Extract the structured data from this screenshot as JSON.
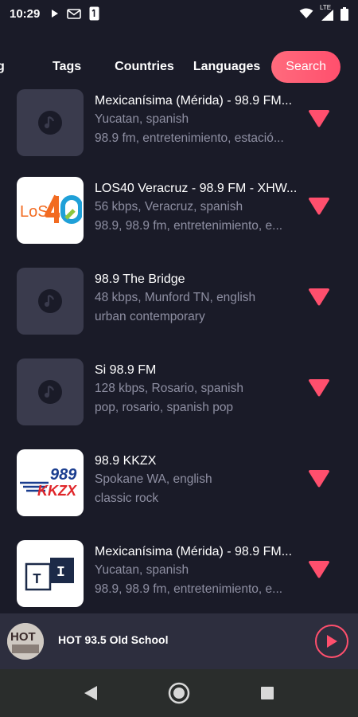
{
  "status_bar": {
    "time": "10:29",
    "network": "LTE"
  },
  "tabs": [
    {
      "label": "g"
    },
    {
      "label": "Tags"
    },
    {
      "label": "Countries"
    },
    {
      "label": "Languages"
    },
    {
      "label": "Search"
    }
  ],
  "stations": [
    {
      "title": "Mexicanísima (Mérida) - 98.9 FM...",
      "line1": "Yucatan, spanish",
      "line2": "98.9 fm, entretenimiento, estació...",
      "logo": "music-note-icon"
    },
    {
      "title": "LOS40 Veracruz - 98.9 FM - XHW...",
      "line1": "56 kbps, Veracruz, spanish",
      "line2": "98.9, 98.9 fm, entretenimiento, e...",
      "logo": "los40-logo",
      "logo_text": "LoS"
    },
    {
      "title": "98.9 The Bridge",
      "line1": "48 kbps, Munford TN, english",
      "line2": "urban contemporary",
      "logo": "music-note-icon"
    },
    {
      "title": "Si 98.9 FM",
      "line1": "128 kbps, Rosario, spanish",
      "line2": "pop, rosario, spanish pop",
      "logo": "music-note-icon"
    },
    {
      "title": "98.9 KKZX",
      "line1": "Spokane WA, english",
      "line2": "classic rock",
      "logo": "kkzx-logo",
      "logo_text": "989",
      "logo_text2": "KKZX"
    },
    {
      "title": "Mexicanísima (Mérida) - 98.9 FM...",
      "line1": "Yucatan, spanish",
      "line2": "98.9, 98.9 fm, entretenimiento, e...",
      "logo": "ti-logo",
      "logo_text": "T",
      "logo_text2": "I"
    }
  ],
  "player": {
    "title": "HOT 93.5 Old School",
    "art_text": "HOT"
  },
  "colors": {
    "accent": "#ff4f6d",
    "background": "#1a1b28",
    "thumb": "#3a3b4d"
  }
}
